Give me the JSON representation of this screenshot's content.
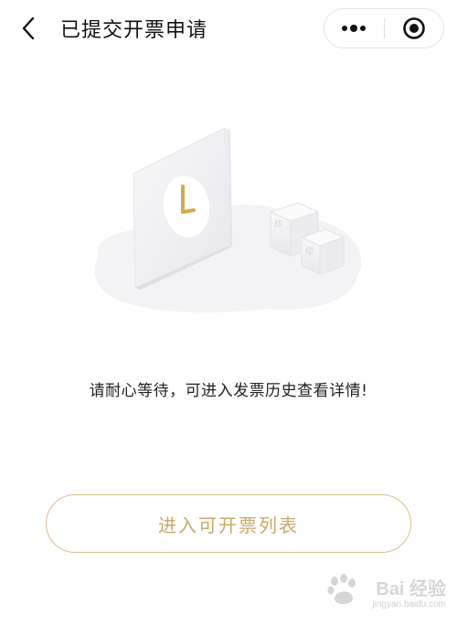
{
  "navbar": {
    "back_icon": "chevron-left-icon",
    "title": "已提交开票申请",
    "more_icon": "more-dots-icon",
    "close_icon": "target-circle-icon"
  },
  "illustration": {
    "icon": "clock-waiting-illustration"
  },
  "main": {
    "message": "请耐心等待，可进入发票历史查看详情!",
    "action_label": "进入可开票列表"
  },
  "watermark": {
    "text": "Bai 经验",
    "url": "jingyan.baidu.com"
  },
  "colors": {
    "accent": "#c9a86a",
    "accent_border": "#d9bf8c",
    "clock_gold": "#d4a84b"
  }
}
